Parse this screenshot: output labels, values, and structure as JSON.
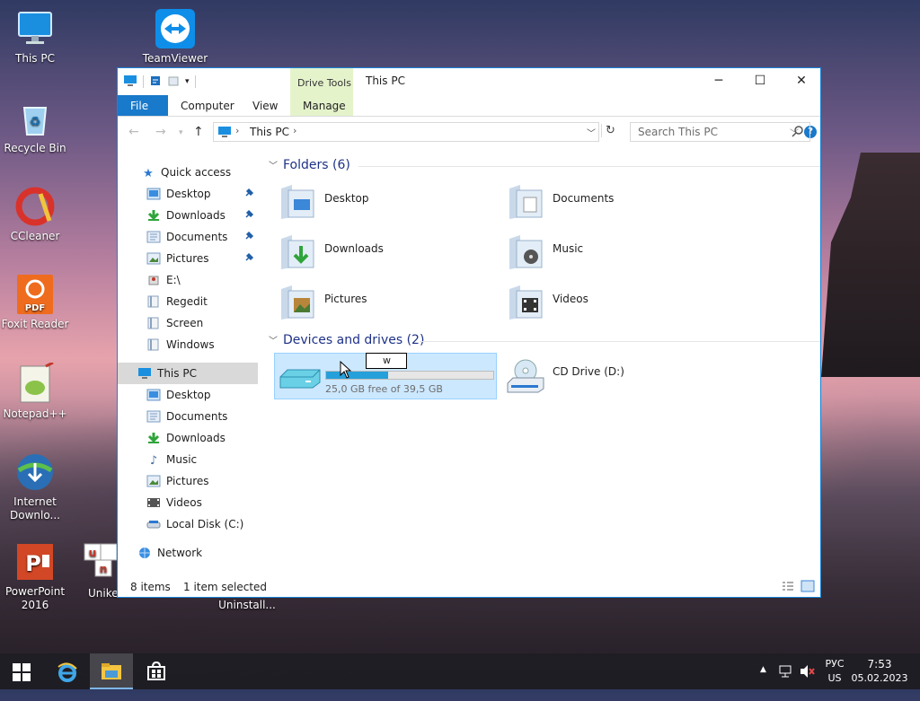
{
  "desktop": {
    "icons": [
      {
        "label": "This PC"
      },
      {
        "label": "Recycle Bin"
      },
      {
        "label": "CCleaner"
      },
      {
        "label": "Foxit Reader"
      },
      {
        "label": "Notepad++"
      },
      {
        "label": "Internet Downlo..."
      },
      {
        "label": "PowerPoint 2016"
      },
      {
        "label": "TeamViewer"
      },
      {
        "label": "Unike"
      },
      {
        "label": "Uninstall..."
      }
    ]
  },
  "window": {
    "title": "This PC",
    "context_group": "Drive Tools",
    "tabs": {
      "file": "File",
      "computer": "Computer",
      "view": "View",
      "manage": "Manage"
    },
    "help": "?",
    "address": "This PC",
    "search_placeholder": "Search This PC"
  },
  "nav": {
    "quick_access": "Quick access",
    "qa_items": [
      "Desktop",
      "Downloads",
      "Documents",
      "Pictures",
      "E:\\",
      "Regedit",
      "Screen",
      "Windows"
    ],
    "this_pc": "This PC",
    "pc_items": [
      "Desktop",
      "Documents",
      "Downloads",
      "Music",
      "Pictures",
      "Videos",
      "Local Disk (C:)"
    ],
    "network": "Network"
  },
  "content": {
    "folders_header": "Folders (6)",
    "folders": [
      "Desktop",
      "Documents",
      "Downloads",
      "Music",
      "Pictures",
      "Videos"
    ],
    "devices_header": "Devices and drives (2)",
    "drive_c": {
      "free_text": "25,0 GB free of 39,5 GB",
      "used_fraction": 0.37,
      "rename_value": "w"
    },
    "drive_d": {
      "label": "CD Drive (D:)"
    }
  },
  "status": {
    "items": "8 items",
    "selected": "1 item selected"
  },
  "taskbar": {
    "lang": "РУС",
    "layout": "US",
    "time": "7:53",
    "date": "05.02.2023"
  },
  "colors": {
    "accent": "#1979ca",
    "selection": "#cce8ff",
    "context_tab": "#e5f3cb"
  }
}
